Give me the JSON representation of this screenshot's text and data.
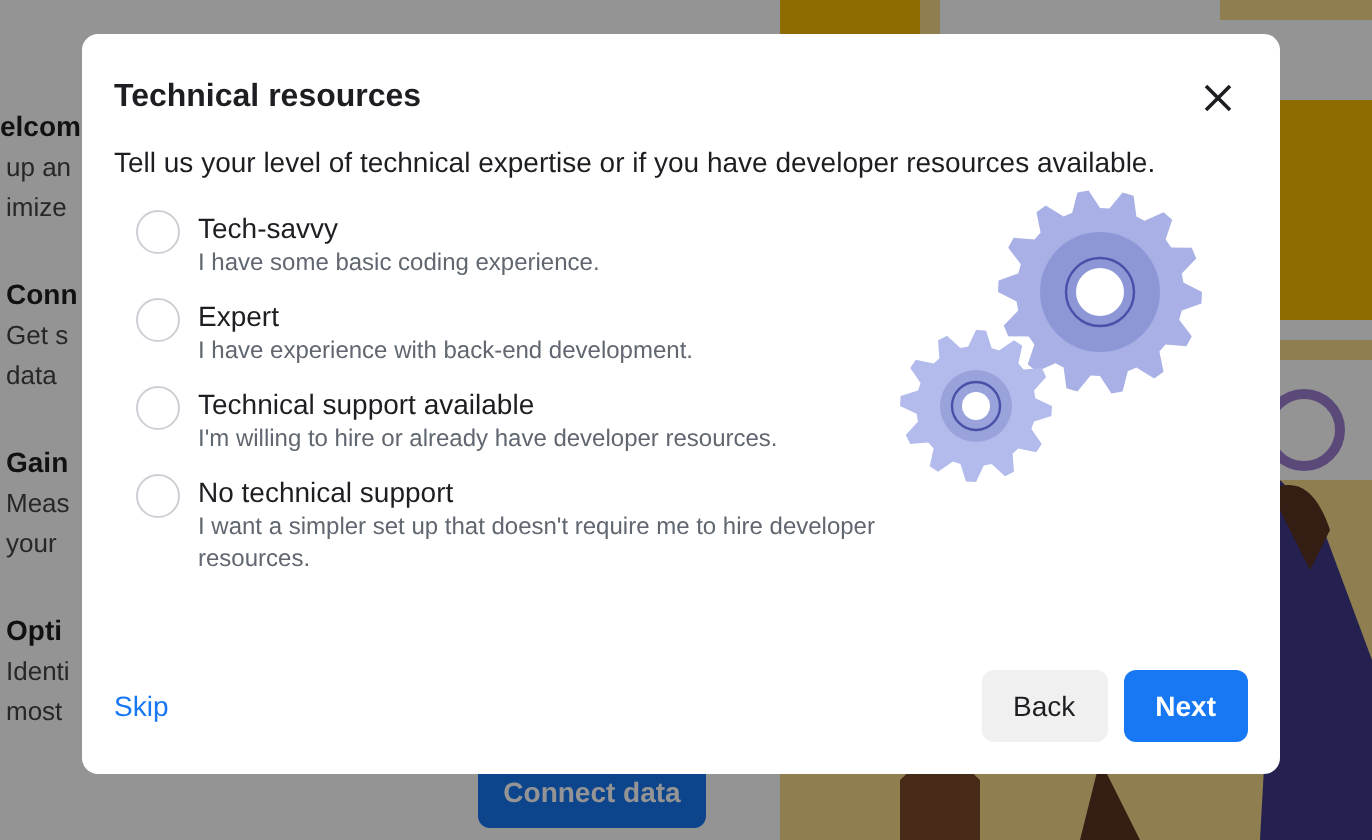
{
  "background": {
    "heading": "elcom",
    "intro": [
      "up an",
      "imize"
    ],
    "sections": [
      {
        "title": "Conn",
        "lines": [
          "Get s",
          "data"
        ]
      },
      {
        "title": "Gain",
        "lines": [
          "Meas",
          "your"
        ]
      },
      {
        "title": "Opti",
        "lines": [
          "Identi",
          "most"
        ]
      }
    ],
    "connect_button": "Connect data",
    "illustration": {
      "kind": "picture"
    }
  },
  "dialog": {
    "title": "Technical resources",
    "description": "Tell us your level of technical expertise or if you have developer resources available.",
    "options": [
      {
        "title": "Tech-savvy",
        "description": "I have some basic coding experience.",
        "selected": false
      },
      {
        "title": "Expert",
        "description": "I have experience with back-end development.",
        "selected": false
      },
      {
        "title": "Technical support available",
        "description": "I'm willing to hire or already have developer resources.",
        "selected": false
      },
      {
        "title": "No technical support",
        "description": "I want a simpler set up that doesn't require me to hire developer resources.",
        "selected": false
      }
    ],
    "skip": "Skip",
    "back": "Back",
    "next": "Next"
  }
}
